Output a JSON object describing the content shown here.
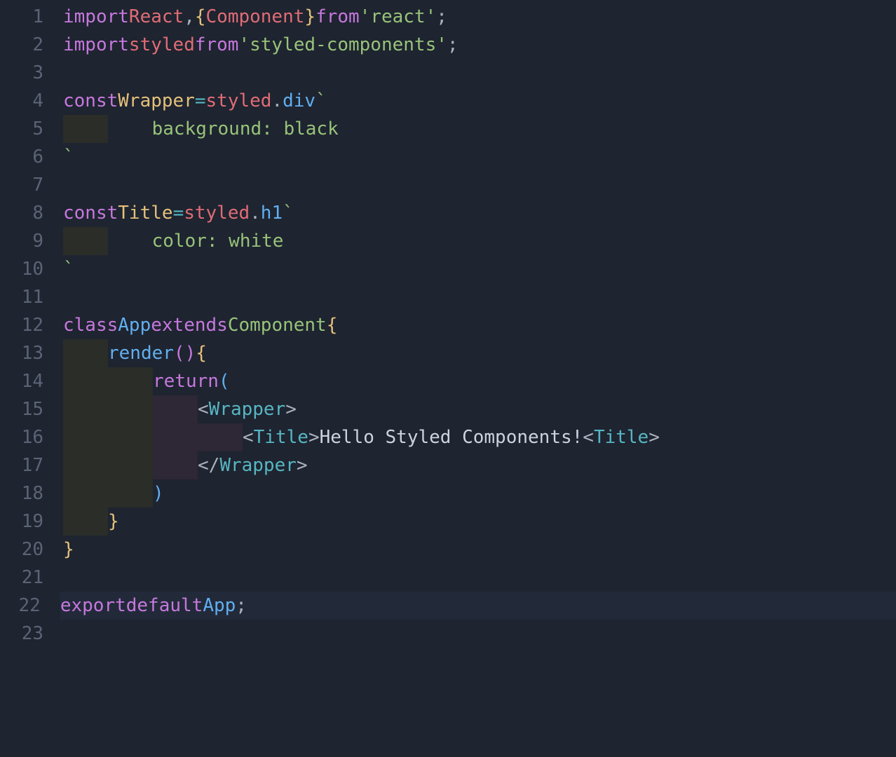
{
  "lineNumbers": [
    "1",
    "2",
    "3",
    "4",
    "5",
    "6",
    "7",
    "8",
    "9",
    "10",
    "11",
    "12",
    "13",
    "14",
    "15",
    "16",
    "17",
    "18",
    "19",
    "20",
    "21",
    "22",
    "23"
  ],
  "code": {
    "l1": {
      "import": "import",
      "react": "React",
      "comma": ",",
      "lbrace": "{",
      "component": "Component",
      "rbrace": "}",
      "from": "from",
      "mod": "'react'",
      "semi": ";"
    },
    "l2": {
      "import": "import",
      "styled": "styled",
      "from": "from",
      "mod": "'styled-components'",
      "semi": ";"
    },
    "l4": {
      "const": "const",
      "name": "Wrapper",
      "eq": "=",
      "styled": "styled",
      "dot": ".",
      "div": "div",
      "bt": "`"
    },
    "l5": {
      "css": "    background: black"
    },
    "l6": {
      "bt": "`"
    },
    "l8": {
      "const": "const",
      "name": "Title",
      "eq": "=",
      "styled": "styled",
      "dot": ".",
      "h1": "h1",
      "bt": "`"
    },
    "l9": {
      "css": "    color: white"
    },
    "l10": {
      "bt": "`"
    },
    "l12": {
      "class": "class",
      "app": "App",
      "extends": "extends",
      "component": "Component",
      "lbrace": "{"
    },
    "l13": {
      "render": "render",
      "parens": "()",
      "lbrace": "{"
    },
    "l14": {
      "return": "return",
      "lp": "("
    },
    "l15": {
      "lt": "<",
      "tag": "Wrapper",
      "gt": ">"
    },
    "l16": {
      "lt": "<",
      "tag": "Title",
      "gt": ">",
      "text": "Hello Styled Components!",
      "lt2": "<",
      "tag2": "Title",
      "gt2": ">"
    },
    "l17": {
      "lt": "</",
      "tag": "Wrapper",
      "gt": ">"
    },
    "l18": {
      "rp": ")"
    },
    "l19": {
      "rbrace": "}"
    },
    "l20": {
      "rbrace": "}"
    },
    "l22": {
      "export": "export",
      "default": "default",
      "app": "App",
      "semi": ";"
    }
  }
}
